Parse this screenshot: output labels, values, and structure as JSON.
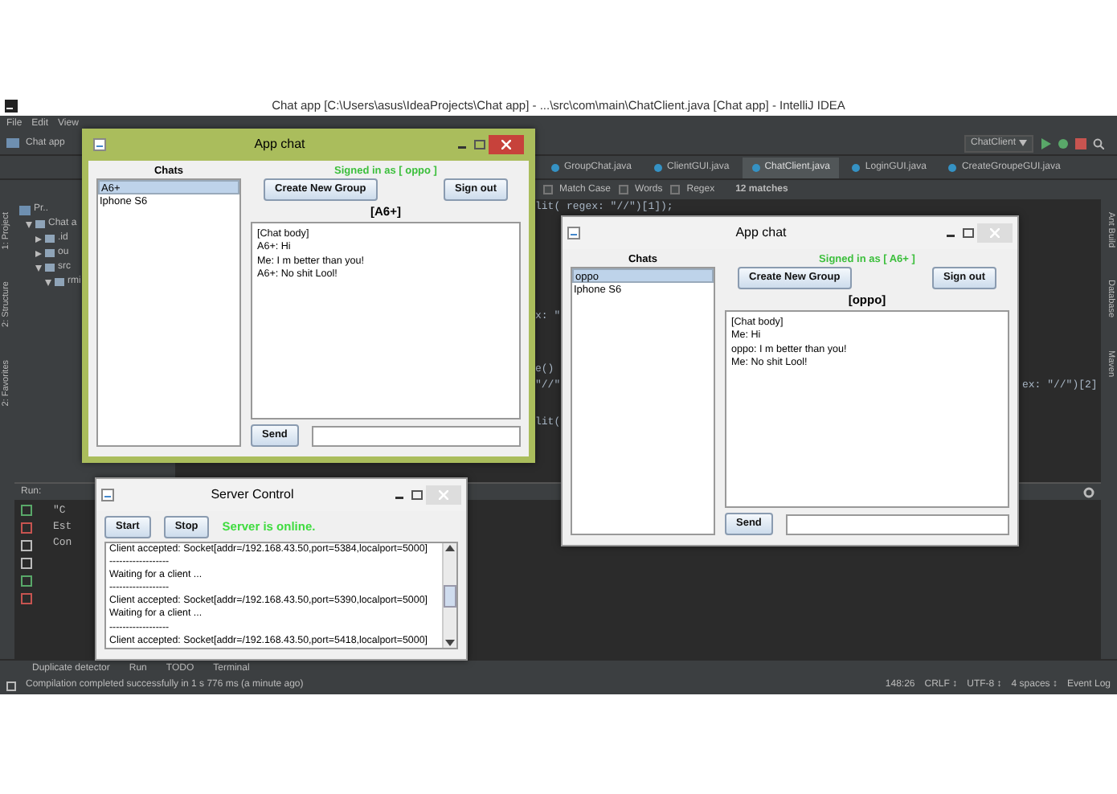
{
  "ide": {
    "title": "Chat app [C:\\Users\\asus\\IdeaProjects\\Chat app] - ...\\src\\com\\main\\ChatClient.java [Chat app] - IntelliJ IDEA",
    "menu": [
      "File",
      "Edit",
      "View"
    ],
    "project_name": "Chat app",
    "run_config": "ChatClient",
    "tabs": [
      {
        "label": "GroupChat.java",
        "selected": false
      },
      {
        "label": "ClientGUI.java",
        "selected": false
      },
      {
        "label": "ChatClient.java",
        "selected": true
      },
      {
        "label": "LoginGUI.java",
        "selected": false
      },
      {
        "label": "CreateGroupeGUI.java",
        "selected": false
      }
    ],
    "find_bar": {
      "options": [
        {
          "label": "Match Case",
          "checked": false
        },
        {
          "label": "Words",
          "checked": false
        },
        {
          "label": "Regex",
          "checked": false
        }
      ],
      "matches": "12 matches"
    },
    "left_tools": [
      "1: Project",
      "2: Structure",
      "2: Favorites"
    ],
    "right_tools": [
      "Ant Build",
      "Database",
      "Maven"
    ],
    "project_panel": {
      "title": "Pr..",
      "tree": [
        {
          "label": "Chat a",
          "expanded": true,
          "children": [
            {
              "label": ".id",
              "expanded": false
            },
            {
              "label": "ou",
              "expanded": false
            },
            {
              "label": "src",
              "expanded": true,
              "children": [
                {
                  "label": "rmi",
                  "expanded": true
                }
              ]
            }
          ]
        }
      ]
    },
    "code_fragments": [
      "lit( regex: \"//\")[1]);",
      "x: \"",
      "e()",
      "\"//\"",
      "lit("
    ],
    "right_code_fragment": "ex: \"//\")[2]",
    "run_panel": {
      "label": "Run:",
      "console": [
        "\"C",
        "Est",
        "Con"
      ]
    },
    "bottom_tabs": [
      "Duplicate detector",
      "Run",
      "TODO",
      "Terminal"
    ],
    "status": {
      "message": "Compilation completed successfully in 1 s 776 ms (a minute ago)",
      "position": "148:26",
      "line_ending": "CRLF ↕",
      "encoding": "UTF-8 ↕",
      "indent": "4 spaces ↕",
      "event_log": "Event Log"
    }
  },
  "windows": [
    {
      "kind": "chat",
      "title": "App chat",
      "active": true,
      "chats_label": "Chats",
      "chats": [
        {
          "name": "A6+",
          "selected": true
        },
        {
          "name": "Iphone S6",
          "selected": false
        }
      ],
      "signed_in": "Signed in as [ oppo ]",
      "create_button": "Create New Group",
      "signout_button": "Sign out",
      "conversation": "[A6+]",
      "messages": [
        "[Chat body]",
        "A6+: Hi",
        "Me: I m better than you!",
        "A6+: No shit Lool!"
      ],
      "send_button": "Send"
    },
    {
      "kind": "chat",
      "title": "App chat",
      "active": false,
      "chats_label": "Chats",
      "chats": [
        {
          "name": "oppo",
          "selected": true
        },
        {
          "name": "Iphone S6",
          "selected": false
        }
      ],
      "signed_in": "Signed in as [ A6+ ]",
      "create_button": "Create New Group",
      "signout_button": "Sign out",
      "conversation": "[oppo]",
      "messages": [
        "[Chat body]",
        "Me: Hi",
        "oppo: I m better than you!",
        "Me: No shit Lool!"
      ],
      "send_button": "Send"
    },
    {
      "kind": "server",
      "title": "Server Control",
      "active": false,
      "start_button": "Start",
      "stop_button": "Stop",
      "status": "Server is online.",
      "log": [
        "Client accepted: Socket[addr=/192.168.43.50,port=5384,localport=5000]",
        "------------------",
        "Waiting for a client ...",
        "------------------",
        "Client accepted: Socket[addr=/192.168.43.50,port=5390,localport=5000]",
        "Waiting for a client ...",
        "------------------",
        "Client accepted: Socket[addr=/192.168.43.50,port=5418,localport=5000]"
      ]
    }
  ]
}
